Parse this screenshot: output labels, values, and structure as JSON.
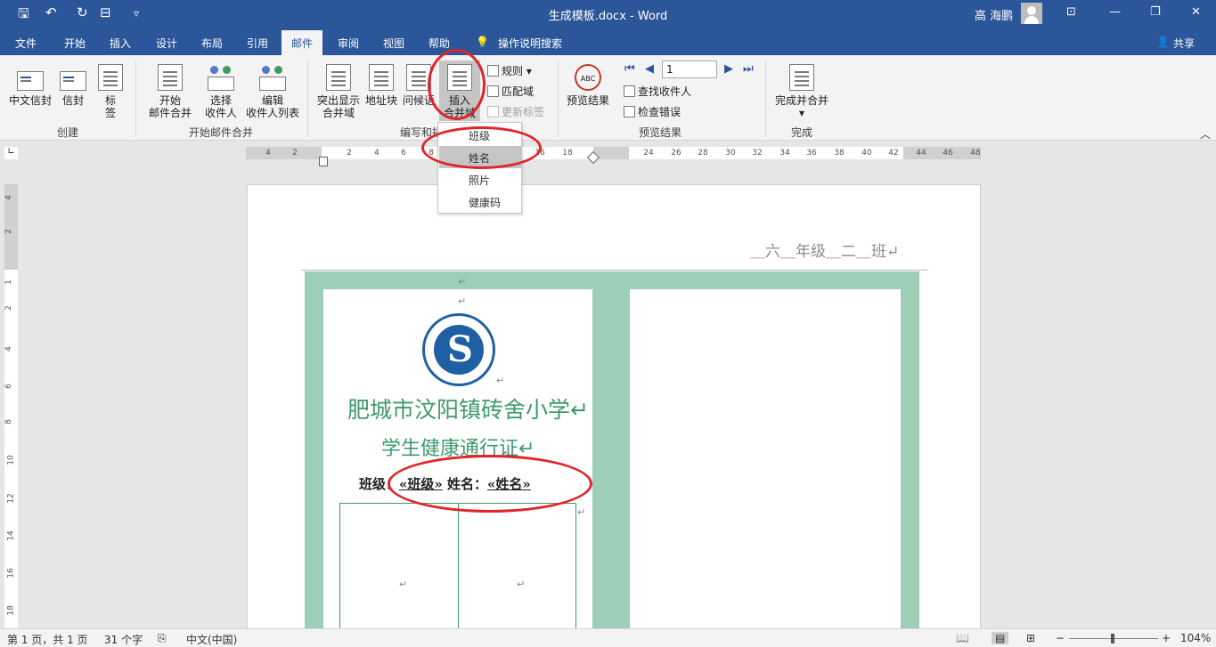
{
  "titlebar": {
    "title": "生成模板.docx  -  Word",
    "user": "高 海鹏",
    "qa_save": "🖫",
    "qa_undo": "↶",
    "qa_redo": "↻",
    "qa_format": "⊟",
    "qa_more": "▿",
    "ribbon_icon": "⊡",
    "minimize": "—",
    "restore": "❐",
    "close": "✕"
  },
  "tabs": [
    "文件",
    "开始",
    "插入",
    "设计",
    "布局",
    "引用",
    "邮件",
    "审阅",
    "视图",
    "帮助"
  ],
  "tell_me": "操作说明搜索",
  "share": "共享",
  "ribbon": {
    "create": {
      "label": "创建",
      "buttons": [
        "中文信封",
        "信封",
        "标签"
      ]
    },
    "start": {
      "label": "开始邮件合并",
      "start_merge": "开始\n邮件合并",
      "select_recipients": "选择\n收件人",
      "edit_list": "编辑\n收件人列表"
    },
    "write": {
      "label": "编写和插",
      "highlight": "突出显示\n合并域",
      "address": "地址块",
      "greeting": "问候语",
      "insert_field": "插入\n合并域",
      "rules": "规则",
      "match": "匹配域",
      "update": "更新标签"
    },
    "preview": {
      "label": "预览结果",
      "preview_btn": "预览结果",
      "find": "查找收件人",
      "check": "检查错误",
      "record": "1"
    },
    "finish": {
      "label": "完成",
      "finish_btn": "完成并合并"
    }
  },
  "dropdown": [
    "班级",
    "姓名",
    "照片",
    "健康码"
  ],
  "ruler_numbers": [
    "4",
    "2",
    "2",
    "4",
    "6",
    "8",
    "16",
    "18",
    "24",
    "26",
    "28",
    "30",
    "32",
    "34",
    "36",
    "38",
    "40",
    "42",
    "44",
    "46",
    "48"
  ],
  "vruler_numbers": [
    "4",
    "2",
    "1",
    "2",
    "4",
    "6",
    "8",
    "10",
    "12",
    "14",
    "16",
    "18"
  ],
  "document": {
    "header": "＿六＿年级＿二＿班↵",
    "school": "肥城市汶阳镇砖舍小学↵",
    "pass": "学生健康通行证↵",
    "fields_prefix1": "班级：",
    "field1": "«班级»",
    "fields_prefix2": "  姓名：",
    "field2": "«姓名»",
    "return_mark": "↵"
  },
  "status": {
    "page": "第 1 页，共 1 页",
    "words": "31 个字",
    "lang": "中文(中国)",
    "zoom": "104%",
    "zoom_level": 0.52
  }
}
